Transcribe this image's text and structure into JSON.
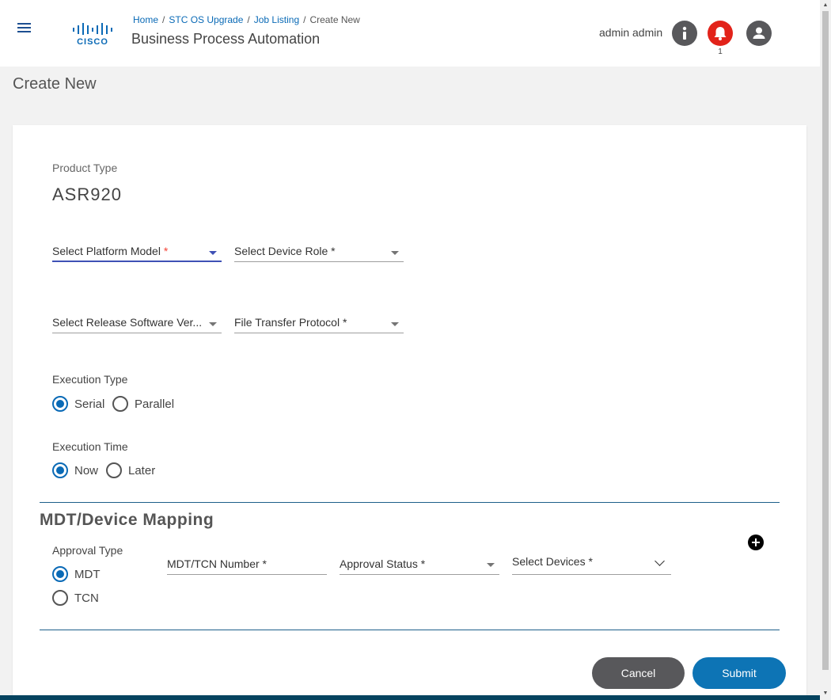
{
  "header": {
    "breadcrumb": [
      {
        "label": "Home",
        "link": true
      },
      {
        "label": "STC OS Upgrade",
        "link": true
      },
      {
        "label": "Job Listing",
        "link": true
      },
      {
        "label": "Create New",
        "link": false
      }
    ],
    "breadcrumb_separator": "/",
    "logo_text": "CISCO",
    "app_title": "Business Process Automation",
    "user_name": "admin admin",
    "notification_count": "1",
    "icons": [
      "menu-icon",
      "info-icon",
      "bell-icon",
      "account-icon"
    ]
  },
  "page_title": "Create New",
  "form": {
    "product_type_label": "Product Type",
    "product_type_value": "ASR920",
    "platform_model": {
      "label": "Select Platform Model",
      "required_mark": "*"
    },
    "device_role": {
      "label": "Select Device Role *"
    },
    "release_software": {
      "label": "Select Release Software Ver..."
    },
    "file_transfer": {
      "label": "File Transfer Protocol *"
    },
    "execution_type": {
      "label": "Execution Type",
      "options": [
        "Serial",
        "Parallel"
      ],
      "selected": "Serial"
    },
    "execution_time": {
      "label": "Execution Time",
      "options": [
        "Now",
        "Later"
      ],
      "selected": "Now"
    }
  },
  "mapping": {
    "title": "MDT/Device Mapping",
    "approval_type": {
      "label": "Approval Type",
      "options": [
        "MDT",
        "TCN"
      ],
      "selected": "MDT"
    },
    "mdt_tcn_number": {
      "label": "MDT/TCN Number *"
    },
    "approval_status": {
      "label": "Approval Status *"
    },
    "select_devices": {
      "label": "Select Devices *"
    }
  },
  "actions": {
    "cancel": "Cancel",
    "submit": "Submit"
  },
  "colors": {
    "accent": "#0a6ab6",
    "submit": "#0d74b5",
    "cancel": "#58585b",
    "alert": "#e2231a",
    "focus": "#3f51b5",
    "required": "#f44336"
  }
}
